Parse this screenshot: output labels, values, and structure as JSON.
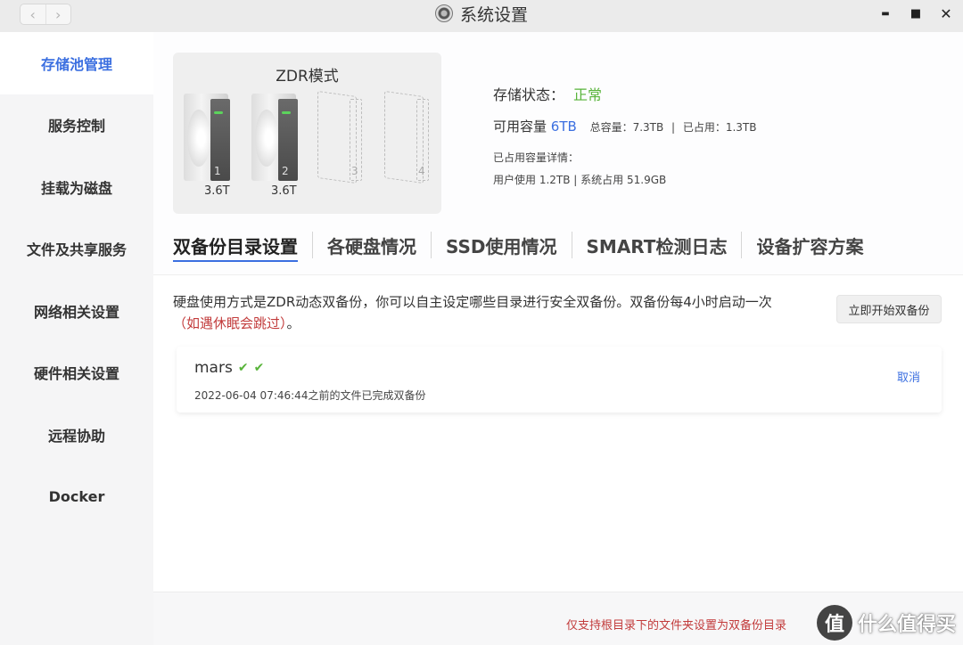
{
  "window": {
    "title": "系统设置",
    "controls": {
      "minimize": "▬",
      "maximize": "■",
      "close": "✕"
    },
    "nav": {
      "back": "‹",
      "forward": "›"
    }
  },
  "sidebar": {
    "items": [
      {
        "label": "存储池管理",
        "active": true
      },
      {
        "label": "服务控制"
      },
      {
        "label": "挂载为磁盘"
      },
      {
        "label": "文件及共享服务"
      },
      {
        "label": "网络相关设置"
      },
      {
        "label": "硬件相关设置"
      },
      {
        "label": "远程协助"
      },
      {
        "label": "Docker"
      }
    ]
  },
  "pool": {
    "mode": "ZDR模式",
    "drives": [
      {
        "num": "1",
        "capacity": "3.6T",
        "present": true
      },
      {
        "num": "2",
        "capacity": "3.6T",
        "present": true
      },
      {
        "num": "3",
        "capacity": "",
        "present": false
      },
      {
        "num": "4",
        "capacity": "",
        "present": false
      }
    ]
  },
  "status": {
    "state_label": "存储状态：",
    "state_value": "正常",
    "available_label": "可用容量",
    "available_value": "6TB",
    "total": "总容量：7.3TB",
    "separator": "|",
    "used": "已占用：1.3TB",
    "detail_label": "已占用容量详情：",
    "user_use": "用户使用 1.2TB",
    "system_use": "系统占用 51.9GB"
  },
  "tabs": [
    {
      "label": "双备份目录设置",
      "active": true
    },
    {
      "label": "各硬盘情况"
    },
    {
      "label": "SSD使用情况"
    },
    {
      "label": "SMART检测日志"
    },
    {
      "label": "设备扩容方案"
    }
  ],
  "backup": {
    "description": "硬盘使用方式是ZDR动态双备份，你可以自主设定哪些目录进行安全双备份。双备份每4小时启动一次",
    "description_note": "（如遇休眠会跳过）",
    "description_end": "。",
    "start_button": "立即开始双备份",
    "entries": [
      {
        "name": "mars",
        "status_text": "2022-06-04 07:46:44之前的文件已完成双备份",
        "cancel": "取消"
      }
    ],
    "footer_note": "仅支持根目录下的文件夹设置为双备份目录"
  },
  "watermark": {
    "icon": "值",
    "text": "什么值得买"
  },
  "colors": {
    "accent": "#3b6fe0",
    "ok": "#58b43a",
    "warn": "#c23b3b"
  }
}
